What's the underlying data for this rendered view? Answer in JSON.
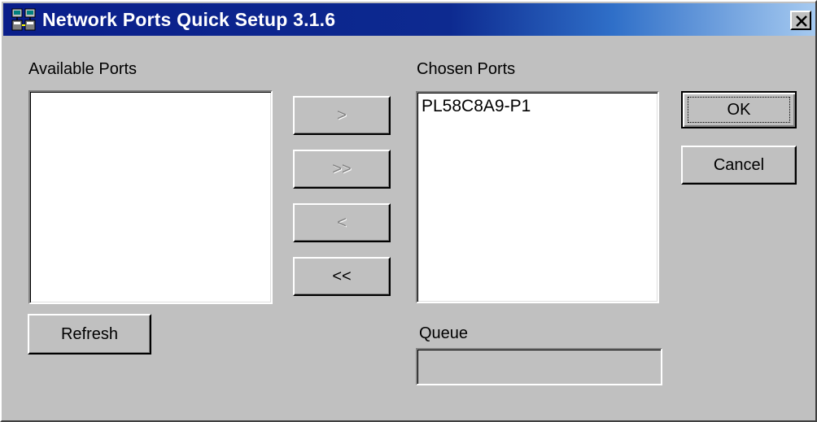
{
  "window": {
    "title": "Network Ports Quick Setup 3.1.6",
    "icon": "network-ports-icon",
    "close_icon": "close-icon",
    "active_title_color": "#0a1e8a",
    "face_color": "#c0c0c0"
  },
  "available": {
    "label": "Available Ports",
    "items": [],
    "refresh_label": "Refresh"
  },
  "transfer": {
    "add_one": ">",
    "add_all": ">>",
    "remove_one": "<",
    "remove_all": "<<"
  },
  "chosen": {
    "label": "Chosen Ports",
    "items": [
      "PL58C8A9-P1"
    ]
  },
  "queue": {
    "label": "Queue",
    "value": ""
  },
  "actions": {
    "ok_label": "OK",
    "cancel_label": "Cancel"
  }
}
